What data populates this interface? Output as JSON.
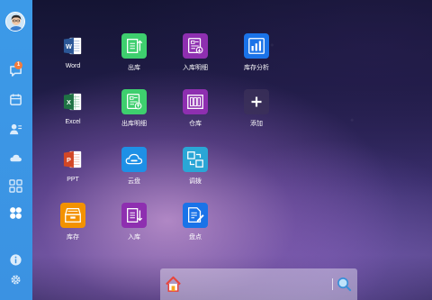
{
  "sidebar": {
    "notification_count": "1",
    "items": [
      {
        "icon": "chat-icon"
      },
      {
        "icon": "calendar-icon"
      },
      {
        "icon": "contacts-icon"
      },
      {
        "icon": "cloud-icon"
      },
      {
        "icon": "apps-grid-icon"
      },
      {
        "icon": "clover-icon"
      },
      {
        "icon": "info-icon"
      },
      {
        "icon": "settings-icon"
      }
    ]
  },
  "apps": [
    {
      "label": "Word",
      "icon": "word-icon",
      "color": "#2b5797"
    },
    {
      "label": "出库",
      "icon": "outbound-icon",
      "color": "#3ecf6e"
    },
    {
      "label": "入库明细",
      "icon": "inbound-detail-icon",
      "color": "#8e2fb0"
    },
    {
      "label": "库存分析",
      "icon": "inventory-analysis-icon",
      "color": "#1a73e8"
    },
    {
      "label": "Excel",
      "icon": "excel-icon",
      "color": "#1f7244"
    },
    {
      "label": "出库明细",
      "icon": "outbound-detail-icon",
      "color": "#3ecf6e"
    },
    {
      "label": "仓库",
      "icon": "warehouse-icon",
      "color": "#8e2fb0"
    },
    {
      "label": "添加",
      "icon": "add-icon",
      "color": "#3a3356"
    },
    {
      "label": "PPT",
      "icon": "ppt-icon",
      "color": "#d24726"
    },
    {
      "label": "云盘",
      "icon": "cloud-drive-icon",
      "color": "#1e90e6"
    },
    {
      "label": "调拨",
      "icon": "transfer-icon",
      "color": "#2aa6d6"
    },
    {
      "label": "库存",
      "icon": "inventory-icon",
      "color": "#f39200"
    },
    {
      "label": "入库",
      "icon": "inbound-icon",
      "color": "#8e2fb0"
    },
    {
      "label": "盘点",
      "icon": "stocktake-icon",
      "color": "#1a73e8"
    }
  ],
  "taskbar": {
    "home_icon": "home-icon",
    "search_icon": "search-icon"
  }
}
